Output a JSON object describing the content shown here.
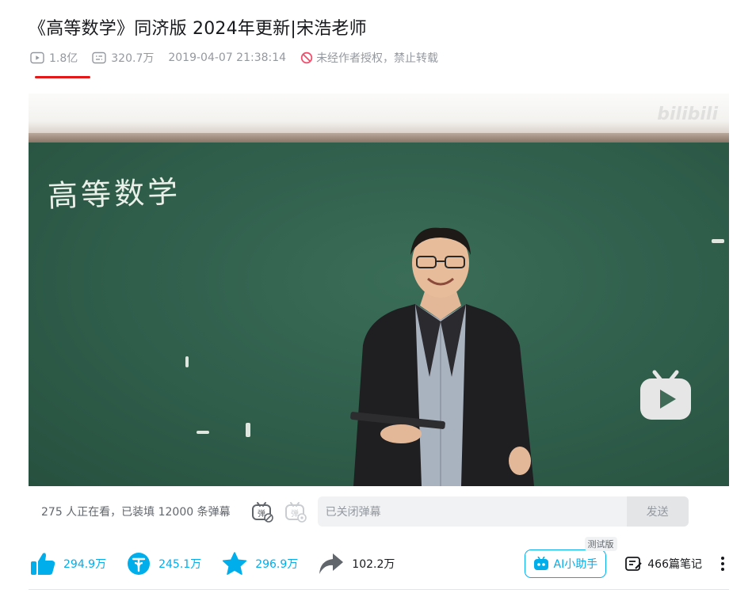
{
  "video": {
    "title": "《高等数学》同济版 2024年更新|宋浩老师",
    "views": "1.8亿",
    "danmaku_total": "320.7万",
    "publish_time": "2019-04-07 21:38:14",
    "copyright_notice": "未经作者授权，禁止转载"
  },
  "player": {
    "watermark": "bilibili",
    "board_text": "高等数学"
  },
  "danmaku_bar": {
    "status": "275 人正在看，已装填 12000 条弹幕",
    "input_placeholder": "已关闭弹幕",
    "send_label": "发送"
  },
  "toolbar": {
    "like_count": "294.9万",
    "coin_count": "245.1万",
    "favorite_count": "296.9万",
    "share_count": "102.2万",
    "ai_label": "AI小助手",
    "ai_badge": "测试版",
    "notes_label": "466篇笔记"
  },
  "colors": {
    "accent": "#00aeec",
    "underline": "#e21918",
    "warn": "#f0506e"
  }
}
